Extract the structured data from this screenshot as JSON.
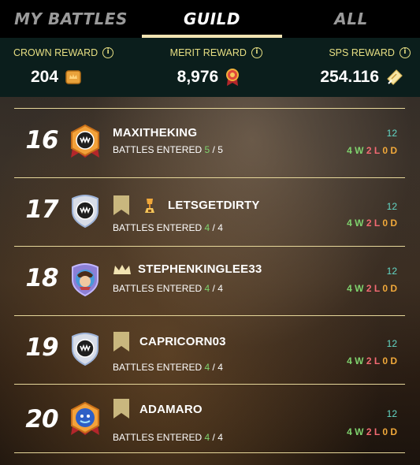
{
  "tabs": [
    {
      "label": "MY BATTLES",
      "active": false
    },
    {
      "label": "GUILD",
      "active": true
    },
    {
      "label": "ALL",
      "active": false
    }
  ],
  "rewards": [
    {
      "label": "CROWN REWARD",
      "value": "204",
      "icon": "crown-reward-icon"
    },
    {
      "label": "MERIT REWARD",
      "value": "8,976",
      "icon": "merit-icon"
    },
    {
      "label": "SPS REWARD",
      "value": "254.116",
      "icon": "sps-icon"
    }
  ],
  "battles_label": "BATTLES ENTERED",
  "rows": [
    {
      "rank": "16",
      "name": "MAXITHEKING",
      "entered": "5",
      "total": "5",
      "rating": "12",
      "w": "4 W",
      "l": "2 L",
      "d": "0 D",
      "badge": "none",
      "avatar": "orange-shield"
    },
    {
      "rank": "17",
      "name": "LETSGETDIRTY",
      "entered": "4",
      "total": "4",
      "rating": "12",
      "w": "4 W",
      "l": "2 L",
      "d": "0 D",
      "badge": "banner+trophy",
      "avatar": "silver-shield"
    },
    {
      "rank": "18",
      "name": "STEPHENKINGLEE33",
      "entered": "4",
      "total": "4",
      "rating": "12",
      "w": "4 W",
      "l": "2 L",
      "d": "0 D",
      "badge": "crown",
      "avatar": "character-portrait"
    },
    {
      "rank": "19",
      "name": "CAPRICORN03",
      "entered": "4",
      "total": "4",
      "rating": "12",
      "w": "4 W",
      "l": "2 L",
      "d": "0 D",
      "badge": "banner",
      "avatar": "silver-shield"
    },
    {
      "rank": "20",
      "name": "ADAMARO",
      "entered": "4",
      "total": "4",
      "rating": "12",
      "w": "4 W",
      "l": "2 L",
      "d": "0 D",
      "badge": "banner",
      "avatar": "blue-character"
    }
  ],
  "colors": {
    "accent": "#f1e3b2",
    "reward_label": "#e7df83",
    "win": "#7fd36e",
    "loss": "#f36a73",
    "draw": "#f0a83a",
    "rating": "#63d8c6"
  }
}
